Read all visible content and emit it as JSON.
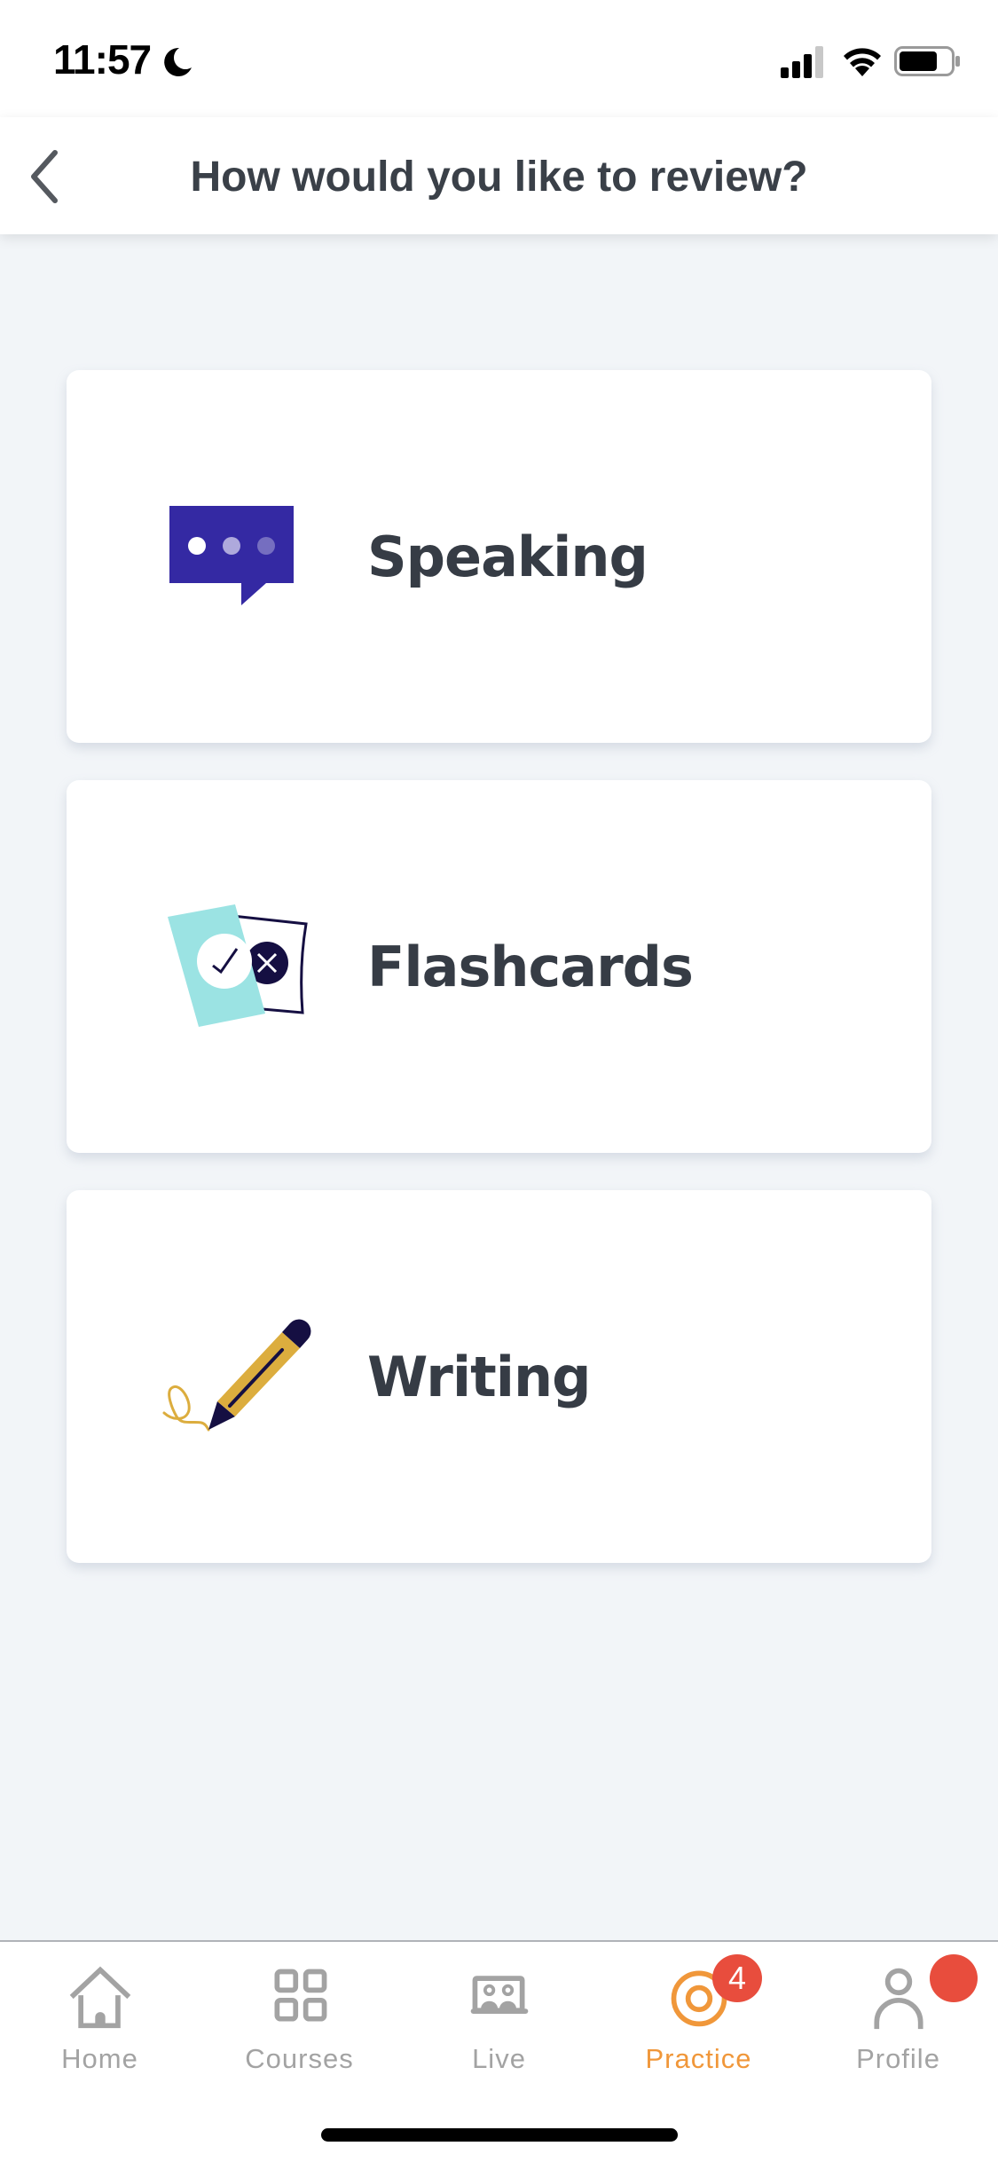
{
  "status_bar": {
    "time": "11:57",
    "focus_mode_icon": "moon-icon",
    "signal_bars": 3,
    "signal_bars_total": 4,
    "battery_level": 0.75
  },
  "header": {
    "back_icon": "chevron-left-icon",
    "title": "How would you like to review?"
  },
  "review_options": [
    {
      "label": "Speaking",
      "icon": "speech-bubble-icon"
    },
    {
      "label": "Flashcards",
      "icon": "flashcards-icon"
    },
    {
      "label": "Writing",
      "icon": "pencil-icon"
    }
  ],
  "colors": {
    "background": "#f2f5f8",
    "card": "#ffffff",
    "title_text": "#3a4048",
    "label_text": "#363c45",
    "speech_purple": "#3429a3",
    "flashcard_teal": "#9be3e3",
    "navy": "#150f42",
    "pencil_yellow": "#dcad3e",
    "tab_inactive": "#a3a3a3",
    "tab_active": "#f0973a",
    "badge_red": "#e84d3d"
  },
  "tab_bar": {
    "tabs": [
      {
        "label": "Home",
        "icon": "home-icon",
        "active": false
      },
      {
        "label": "Courses",
        "icon": "grid-icon",
        "active": false
      },
      {
        "label": "Live",
        "icon": "live-class-icon",
        "active": false
      },
      {
        "label": "Practice",
        "icon": "target-icon",
        "active": true,
        "badge": "4"
      },
      {
        "label": "Profile",
        "icon": "person-icon",
        "active": false,
        "dot": true
      }
    ]
  }
}
